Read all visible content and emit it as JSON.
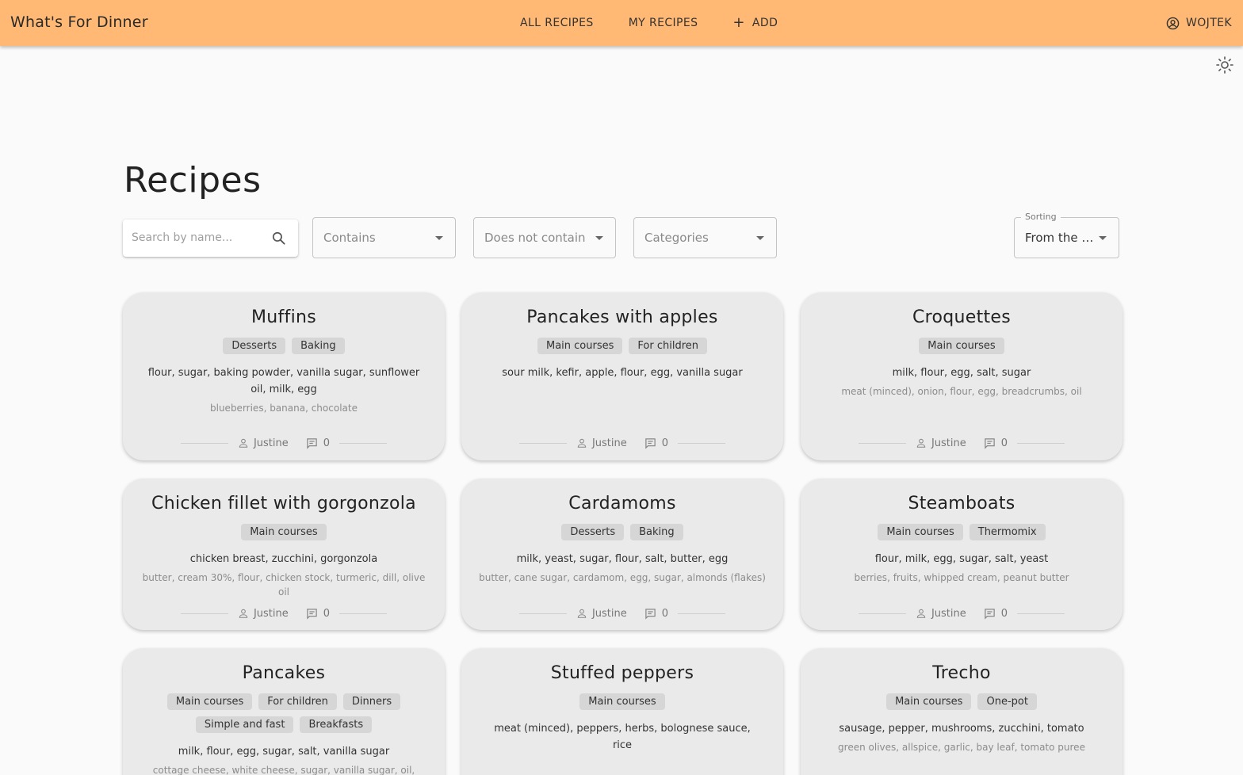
{
  "app": {
    "brand": "What's For Dinner",
    "nav": [
      {
        "label": "ALL RECIPES"
      },
      {
        "label": "MY RECIPES"
      },
      {
        "label": "ADD",
        "icon": "plus-icon"
      }
    ],
    "user": {
      "name": "WOJTEK",
      "icon": "account-circle-icon"
    },
    "theme_icon": "sun-icon",
    "accent_color": "#ffb974"
  },
  "page": {
    "title": "Recipes"
  },
  "filters": {
    "search_placeholder": "Search by name...",
    "contains": "Contains",
    "not_contains": "Does not contain",
    "categories": "Categories",
    "sorting_label": "Sorting",
    "sorting_value": "From the oldest"
  },
  "recipes": [
    {
      "title": "Muffins",
      "tags": [
        "Desserts",
        "Baking"
      ],
      "ingredients": "flour, sugar, baking powder, vanilla sugar, sunflower oil, milk, egg",
      "extras": "blueberries, banana, chocolate",
      "author": "Justine",
      "comments": "0"
    },
    {
      "title": "Pancakes with apples",
      "tags": [
        "Main courses",
        "For children"
      ],
      "ingredients": "sour milk, kefir, apple, flour, egg, vanilla sugar",
      "extras": "",
      "author": "Justine",
      "comments": "0"
    },
    {
      "title": "Croquettes",
      "tags": [
        "Main courses"
      ],
      "ingredients": "milk, flour, egg, salt, sugar",
      "extras": "meat (minced), onion, flour, egg, breadcrumbs, oil",
      "author": "Justine",
      "comments": "0"
    },
    {
      "title": "Chicken fillet with gorgonzola",
      "tags": [
        "Main courses"
      ],
      "ingredients": "chicken breast, zucchini, gorgonzola",
      "extras": "butter, cream 30%, flour, chicken stock, turmeric, dill, olive oil",
      "author": "Justine",
      "comments": "0"
    },
    {
      "title": "Cardamoms",
      "tags": [
        "Desserts",
        "Baking"
      ],
      "ingredients": "milk, yeast, sugar, flour, salt, butter, egg",
      "extras": "butter, cane sugar, cardamom, egg, sugar, almonds (flakes)",
      "author": "Justine",
      "comments": "0"
    },
    {
      "title": "Steamboats",
      "tags": [
        "Main courses",
        "Thermomix"
      ],
      "ingredients": "flour, milk, egg, sugar, salt, yeast",
      "extras": "berries, fruits, whipped cream, peanut butter",
      "author": "Justine",
      "comments": "0"
    },
    {
      "title": "Pancakes",
      "tags": [
        "Main courses",
        "For children",
        "Dinners",
        "Simple and fast",
        "Breakfasts"
      ],
      "ingredients": "milk, flour, egg, sugar, salt, vanilla sugar",
      "extras": "cottage cheese, white cheese, sugar, vanilla sugar, oil,",
      "author": "",
      "comments": ""
    },
    {
      "title": "Stuffed peppers",
      "tags": [
        "Main courses"
      ],
      "ingredients": "meat (minced), peppers, herbs, bolognese sauce, rice",
      "extras": "",
      "author": "",
      "comments": ""
    },
    {
      "title": "Trecho",
      "tags": [
        "Main courses",
        "One-pot"
      ],
      "ingredients": "sausage, pepper, mushrooms, zucchini, tomato",
      "extras": "green olives, allspice, garlic, bay leaf, tomato puree",
      "author": "",
      "comments": ""
    }
  ]
}
